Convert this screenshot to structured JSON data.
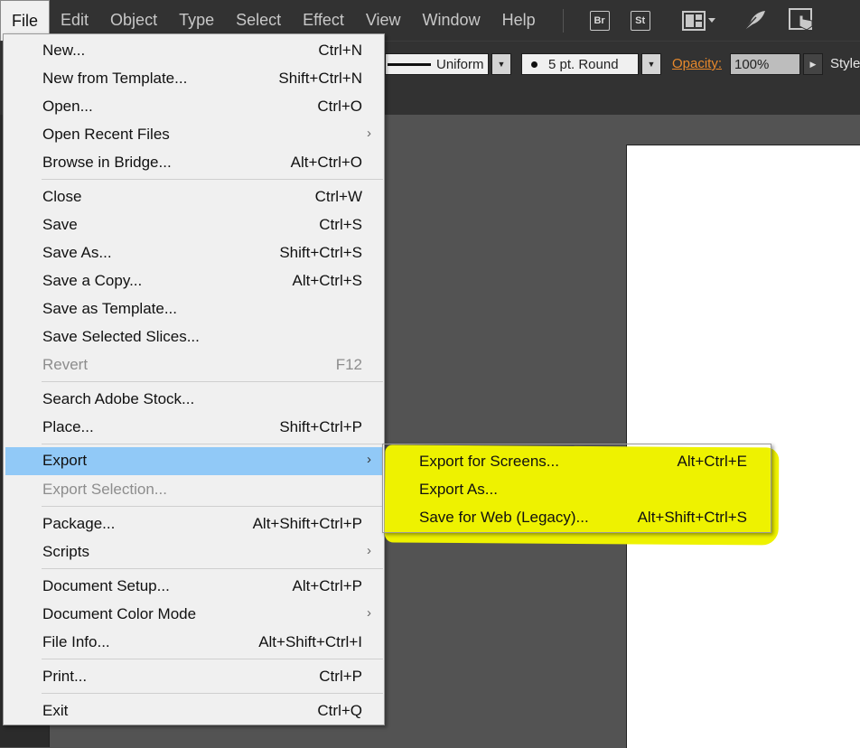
{
  "menubar": {
    "items": [
      "File",
      "Edit",
      "Object",
      "Type",
      "Select",
      "Effect",
      "View",
      "Window",
      "Help"
    ],
    "active": "File",
    "icons": {
      "bridge": "Br",
      "stock": "St",
      "workspace": "workspace-layout-icon",
      "feather": "feather-icon",
      "gpu": "touch-icon"
    }
  },
  "controlbar": {
    "stroke_profile": "Uniform",
    "brush": "5 pt. Round",
    "opacity_label": "Opacity:",
    "opacity_value": "100%",
    "style_label": "Style"
  },
  "file_menu": [
    {
      "label": "New...",
      "shortcut": "Ctrl+N"
    },
    {
      "label": "New from Template...",
      "shortcut": "Shift+Ctrl+N"
    },
    {
      "label": "Open...",
      "shortcut": "Ctrl+O"
    },
    {
      "label": "Open Recent Files",
      "submenu": true
    },
    {
      "label": "Browse in Bridge...",
      "shortcut": "Alt+Ctrl+O"
    },
    {
      "label": "Close",
      "shortcut": "Ctrl+W"
    },
    {
      "label": "Save",
      "shortcut": "Ctrl+S"
    },
    {
      "label": "Save As...",
      "shortcut": "Shift+Ctrl+S"
    },
    {
      "label": "Save a Copy...",
      "shortcut": "Alt+Ctrl+S"
    },
    {
      "label": "Save as Template..."
    },
    {
      "label": "Save Selected Slices..."
    },
    {
      "label": "Revert",
      "shortcut": "F12",
      "disabled": true
    },
    {
      "label": "Search Adobe Stock..."
    },
    {
      "label": "Place...",
      "shortcut": "Shift+Ctrl+P"
    },
    {
      "label": "Export",
      "submenu": true,
      "highlighted": true
    },
    {
      "label": "Export Selection...",
      "disabled": true
    },
    {
      "label": "Package...",
      "shortcut": "Alt+Shift+Ctrl+P"
    },
    {
      "label": "Scripts",
      "submenu": true
    },
    {
      "label": "Document Setup...",
      "shortcut": "Alt+Ctrl+P"
    },
    {
      "label": "Document Color Mode",
      "submenu": true
    },
    {
      "label": "File Info...",
      "shortcut": "Alt+Shift+Ctrl+I"
    },
    {
      "label": "Print...",
      "shortcut": "Ctrl+P"
    },
    {
      "label": "Exit",
      "shortcut": "Ctrl+Q"
    }
  ],
  "export_submenu": [
    {
      "label": "Export for Screens...",
      "shortcut": "Alt+Ctrl+E"
    },
    {
      "label": "Export As..."
    },
    {
      "label": "Save for Web (Legacy)...",
      "shortcut": "Alt+Shift+Ctrl+S"
    }
  ],
  "colors": {
    "highlight": "#91c9f7",
    "marker": "#eef200",
    "opacity_label": "#e8892c"
  }
}
